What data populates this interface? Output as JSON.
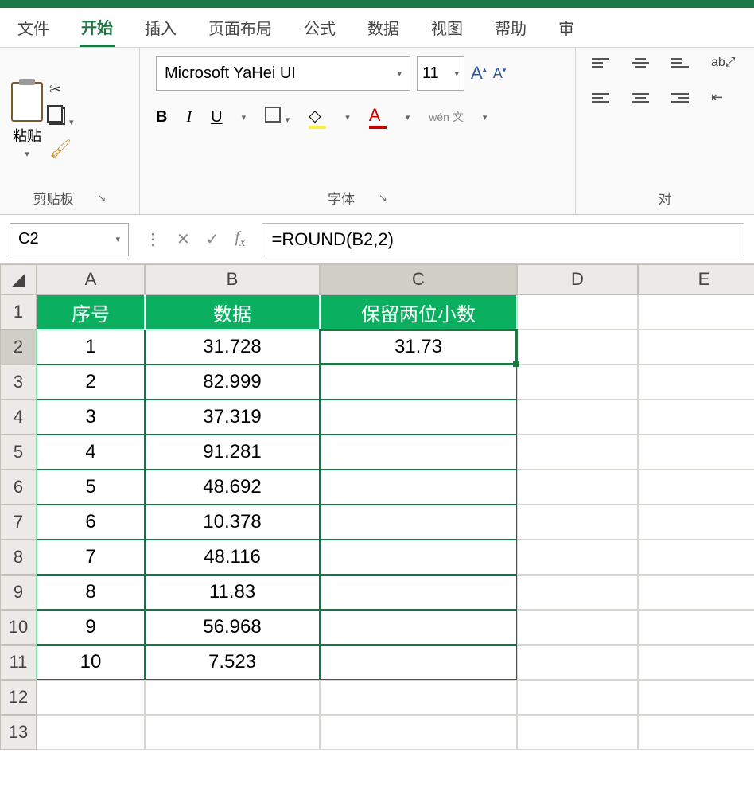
{
  "tabs": {
    "file": "文件",
    "home": "开始",
    "insert": "插入",
    "pagelayout": "页面布局",
    "formulas": "公式",
    "data": "数据",
    "view": "视图",
    "help": "帮助",
    "review": "审"
  },
  "ribbon": {
    "clipboard": {
      "paste": "粘贴",
      "label": "剪贴板"
    },
    "font": {
      "name": "Microsoft YaHei UI",
      "size": "11",
      "bold": "B",
      "italic": "I",
      "underline": "U",
      "fill": "◇",
      "color": "A",
      "phonetic": "wén 文",
      "label": "字体"
    },
    "align": {
      "label": "对"
    }
  },
  "formulaBar": {
    "nameBox": "C2",
    "formula": "=ROUND(B2,2)"
  },
  "columns": [
    "A",
    "B",
    "C",
    "D",
    "E"
  ],
  "rowNumbers": [
    "1",
    "2",
    "3",
    "4",
    "5",
    "6",
    "7",
    "8",
    "9",
    "10",
    "11",
    "12",
    "13"
  ],
  "table": {
    "headers": {
      "A": "序号",
      "B": "数据",
      "C": "保留两位小数"
    },
    "rows": [
      {
        "A": "1",
        "B": "31.728",
        "C": "31.73"
      },
      {
        "A": "2",
        "B": "82.999",
        "C": ""
      },
      {
        "A": "3",
        "B": "37.319",
        "C": ""
      },
      {
        "A": "4",
        "B": "91.281",
        "C": ""
      },
      {
        "A": "5",
        "B": "48.692",
        "C": ""
      },
      {
        "A": "6",
        "B": "10.378",
        "C": ""
      },
      {
        "A": "7",
        "B": "48.116",
        "C": ""
      },
      {
        "A": "8",
        "B": "11.83",
        "C": ""
      },
      {
        "A": "9",
        "B": "56.968",
        "C": ""
      },
      {
        "A": "10",
        "B": "7.523",
        "C": ""
      }
    ]
  },
  "selected": {
    "cell": "C2",
    "row": 2,
    "col": "C"
  }
}
